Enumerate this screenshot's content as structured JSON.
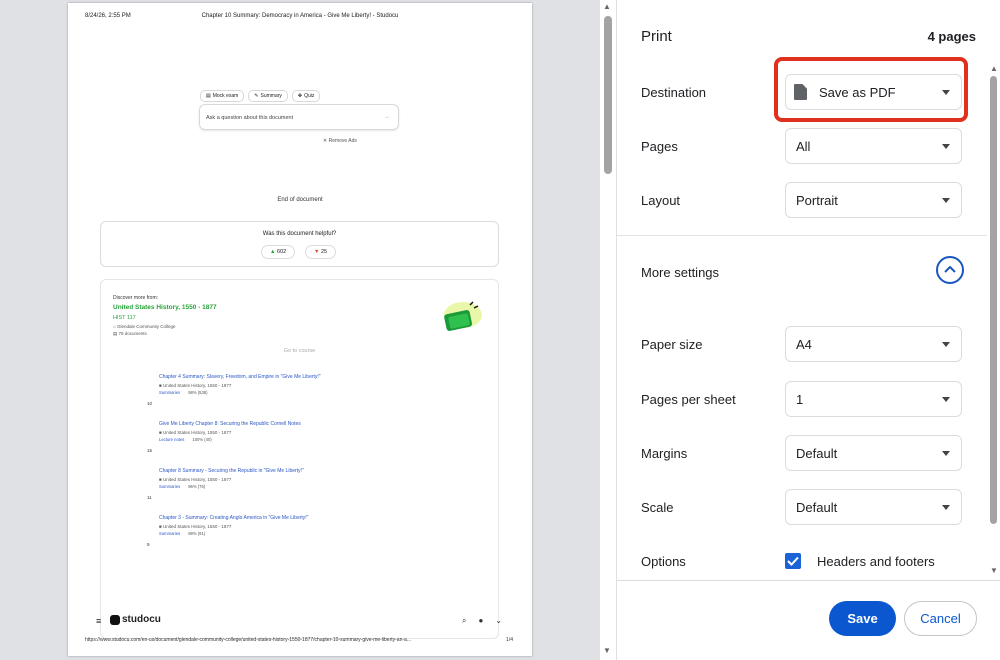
{
  "preview": {
    "header_date": "8/24/26, 2:55 PM",
    "header_title": "Chapter 10 Summary: Democracy in America - Give Me Liberty! - Studocu",
    "chips": [
      "Mock exam",
      "Summary",
      "Quiz"
    ],
    "ask_placeholder": "Ask a question about this document",
    "remove_ads": "✕ Remove Ads",
    "end_of_document": "End of document",
    "helpful_question": "Was this document helpful?",
    "votes_up": "602",
    "votes_down": "25",
    "discover_label": "Discover more from:",
    "course_name": "United States History, 1550 - 1877",
    "course_code": "HIST 117",
    "college": "Glendale Community College",
    "documents_count": "79 documents",
    "go_to_course": "Go to course",
    "related": [
      {
        "title": "Chapter 4 Summary: Slavery, Freedom, and Empire in \"Give Me Liberty!\"",
        "course": "United States History, 1550 - 1877",
        "tag": "Summaries",
        "rating": "98% (536)",
        "num": "10"
      },
      {
        "title": "Give Me Liberty Chapter 8: Securing the Republic Cornell Notes",
        "course": "United States History, 1550 - 1877",
        "tag": "Lecture notes",
        "rating": "100% (40)",
        "num": "15"
      },
      {
        "title": "Chapter 8 Summary - Securing the Republic in \"Give Me Liberty!\"",
        "course": "United States History, 1550 - 1877",
        "tag": "Summaries",
        "rating": "96% (76)",
        "num": "11"
      },
      {
        "title": "Chapter 3 - Summary: Creating Anglo America in \"Give Me Liberty!\"",
        "course": "United States History, 1550 - 1877",
        "tag": "Summaries",
        "rating": "98% (91)",
        "num": "9"
      }
    ],
    "logo_text": "studocu",
    "footer_url": "https://www.studocu.com/en-us/document/glendale-community-college/united-states-history-1550-1877/chapter-10-summary-give-me-liberty-an-a...",
    "page_number": "1/4"
  },
  "panel": {
    "title": "Print",
    "page_count": "4 pages",
    "destination": {
      "label": "Destination",
      "value": "Save as PDF"
    },
    "pages": {
      "label": "Pages",
      "value": "All"
    },
    "layout": {
      "label": "Layout",
      "value": "Portrait"
    },
    "more_settings": "More settings",
    "paper_size": {
      "label": "Paper size",
      "value": "A4"
    },
    "pages_per_sheet": {
      "label": "Pages per sheet",
      "value": "1"
    },
    "margins": {
      "label": "Margins",
      "value": "Default"
    },
    "scale": {
      "label": "Scale",
      "value": "Default"
    },
    "options": {
      "label": "Options",
      "checkbox_label": "Headers and footers",
      "checked": true
    },
    "save_label": "Save",
    "cancel_label": "Cancel"
  },
  "colors": {
    "accent": "#0b57d0",
    "highlight": "#e0301e",
    "course_green": "#27a33a",
    "link_blue": "#2a56c6"
  }
}
